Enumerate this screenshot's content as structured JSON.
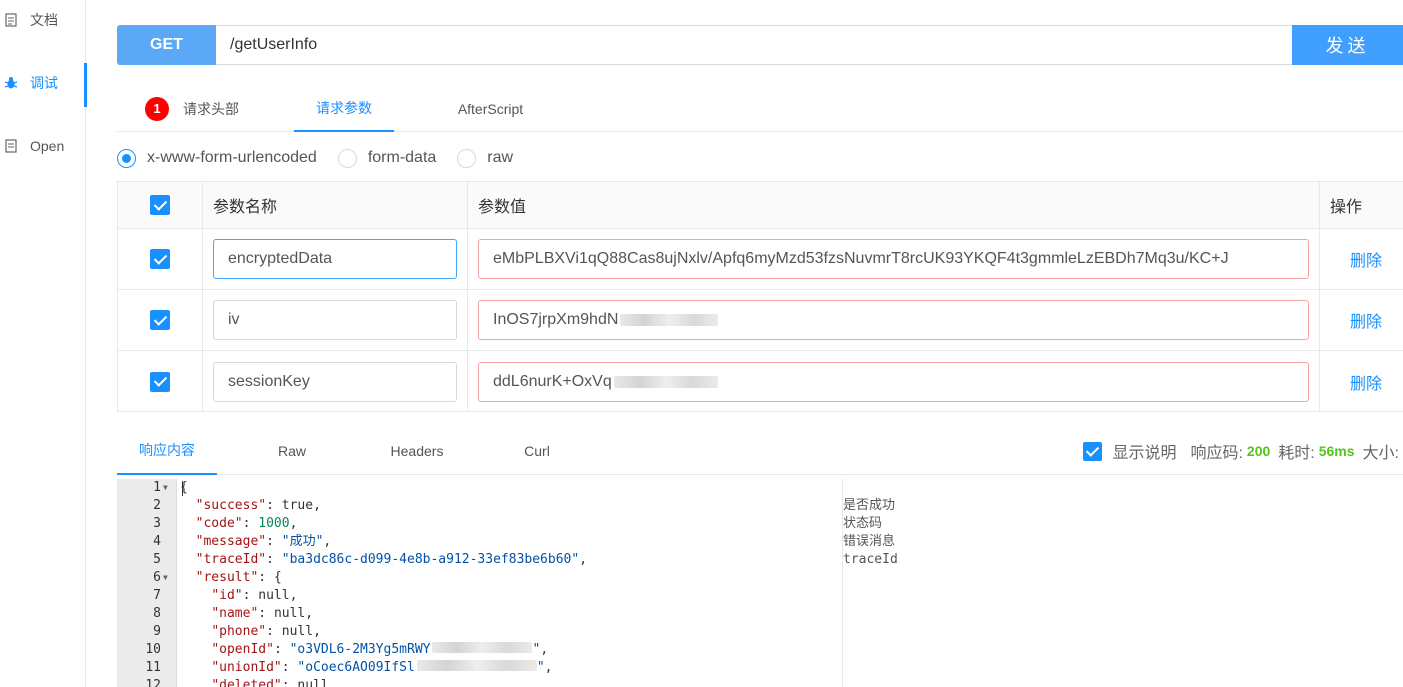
{
  "sidebar": {
    "items": [
      {
        "label": "文档",
        "icon": "document-icon"
      },
      {
        "label": "调试",
        "icon": "bug-icon",
        "active": true
      },
      {
        "label": "Open",
        "icon": "open-icon"
      }
    ]
  },
  "request": {
    "method": "GET",
    "url": "/getUserInfo",
    "send_label": "发送"
  },
  "request_tabs": [
    {
      "label": "请求头部",
      "badge": "1"
    },
    {
      "label": "请求参数",
      "active": true
    },
    {
      "label": "AfterScript"
    }
  ],
  "body_types": [
    {
      "label": "x-www-form-urlencoded",
      "checked": true
    },
    {
      "label": "form-data",
      "checked": false
    },
    {
      "label": "raw",
      "checked": false
    }
  ],
  "params_table": {
    "headers": {
      "name": "参数名称",
      "value": "参数值",
      "op": "操作"
    },
    "rows": [
      {
        "name": "encryptedData",
        "value": "eMbPLBXVi1qQ88Cas8ujNxlv/Apfq6myMzd53fzsNuvmrT8rcUK93YKQF4t3gmmleLzEBDh7Mq3u/KC+J",
        "delete": "删除"
      },
      {
        "name": "iv",
        "value": "InOS7jrpXm9hdN",
        "delete": "删除"
      },
      {
        "name": "sessionKey",
        "value": "ddL6nurK+OxVq",
        "delete": "删除"
      }
    ]
  },
  "response_tabs": [
    {
      "label": "响应内容",
      "active": true
    },
    {
      "label": "Raw"
    },
    {
      "label": "Headers"
    },
    {
      "label": "Curl"
    }
  ],
  "response_meta": {
    "show_desc_label": "显示说明",
    "code_label": "响应码:",
    "code_value": "200",
    "time_label": "耗时:",
    "time_value": "56ms",
    "size_label": "大小:"
  },
  "response_lines": [
    {
      "n": "1",
      "fold": true
    },
    {
      "n": "2",
      "desc": "是否成功"
    },
    {
      "n": "3",
      "desc": "状态码"
    },
    {
      "n": "4",
      "desc": "错误消息"
    },
    {
      "n": "5",
      "desc": "traceId"
    },
    {
      "n": "6",
      "fold": true
    },
    {
      "n": "7"
    },
    {
      "n": "8"
    },
    {
      "n": "9"
    },
    {
      "n": "10"
    },
    {
      "n": "11"
    },
    {
      "n": "12"
    }
  ],
  "response_json": {
    "open_brace": "{",
    "success_key": "\"success\"",
    "success_val": "true",
    "code_key": "\"code\"",
    "code_val": "1000",
    "message_key": "\"message\"",
    "message_val": "\"成功\"",
    "traceId_key": "\"traceId\"",
    "traceId_val": "\"ba3dc86c-d099-4e8b-a912-33ef83be6b60\"",
    "result_key": "\"result\"",
    "id_key": "\"id\"",
    "name_key": "\"name\"",
    "phone_key": "\"phone\"",
    "null_val": "null",
    "openId_key": "\"openId\"",
    "openId_val": "\"o3VDL6-2M3Yg5mRWY",
    "unionId_key": "\"unionId\"",
    "unionId_val": "\"oCoec6AO09IfSl",
    "deleted_key": "\"deleted\""
  }
}
